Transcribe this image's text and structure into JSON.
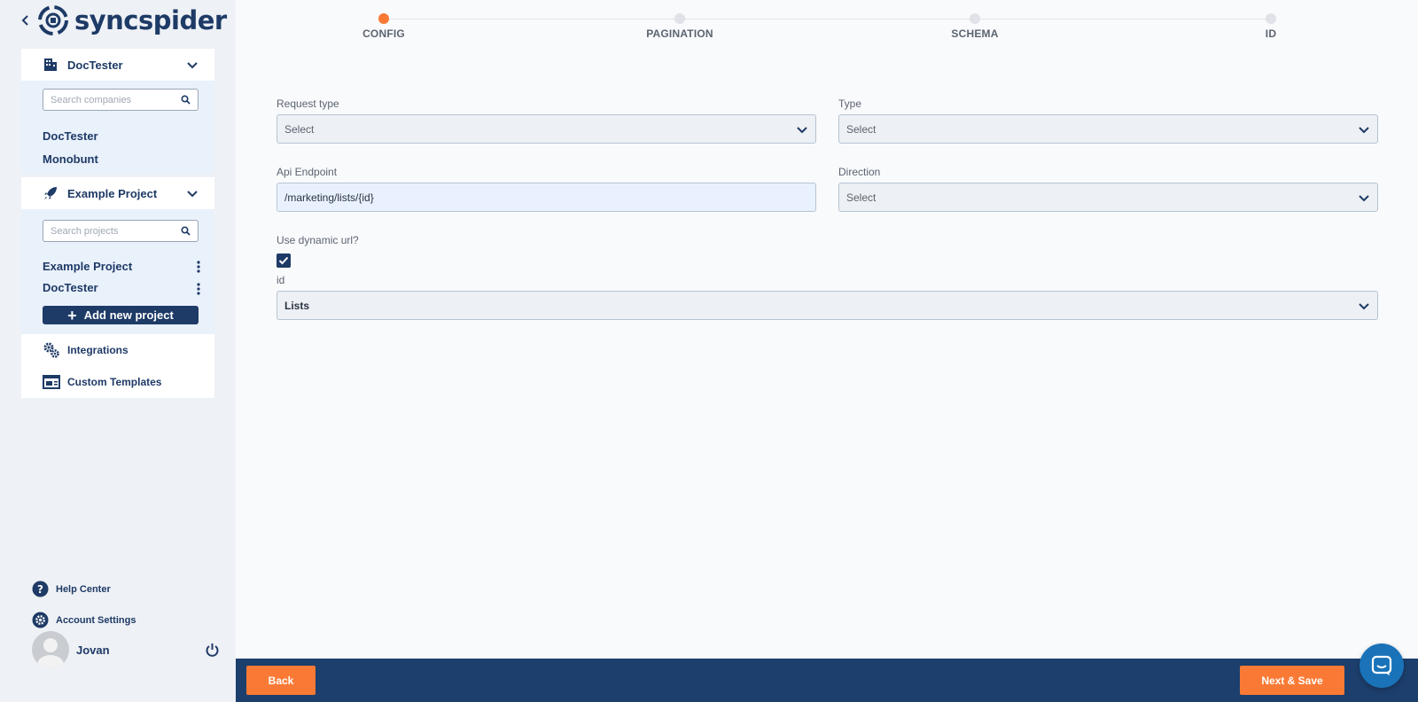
{
  "app": {
    "logo_text": "syncspider"
  },
  "company_section": {
    "title": "DocTester",
    "search_placeholder": "Search companies",
    "items": [
      {
        "label": "DocTester"
      },
      {
        "label": "Monobunt"
      }
    ]
  },
  "project_section": {
    "title": "Example Project",
    "search_placeholder": "Search projects",
    "items": [
      {
        "label": "Example Project"
      },
      {
        "label": "DocTester"
      }
    ],
    "add_label": "Add new project"
  },
  "nav": {
    "integrations": "Integrations",
    "custom_templates": "Custom Templates"
  },
  "bottom": {
    "help_center": "Help Center",
    "account_settings": "Account Settings",
    "user_name": "Jovan"
  },
  "stepper": {
    "active_step": "CONFIG",
    "steps": [
      {
        "label": "CONFIG"
      },
      {
        "label": "PAGINATION"
      },
      {
        "label": "SCHEMA"
      },
      {
        "label": "ID"
      }
    ]
  },
  "form": {
    "request_type": {
      "label": "Request type",
      "value": "Select"
    },
    "type": {
      "label": "Type",
      "value": "Select"
    },
    "api_endpoint": {
      "label": "Api Endpoint",
      "value": "/marketing/lists/{id}"
    },
    "direction": {
      "label": "Direction",
      "value": "Select"
    },
    "dynamic_url": {
      "label": "Use dynamic url?",
      "checked": true
    },
    "id_field": {
      "label": "id",
      "value": "Lists"
    }
  },
  "footer": {
    "back_label": "Back",
    "next_label": "Next & Save"
  },
  "colors": {
    "navy": "#1e3a66",
    "footer": "#1d3f6d",
    "accent": "#fa7a35",
    "chat": "#1a73b8"
  }
}
